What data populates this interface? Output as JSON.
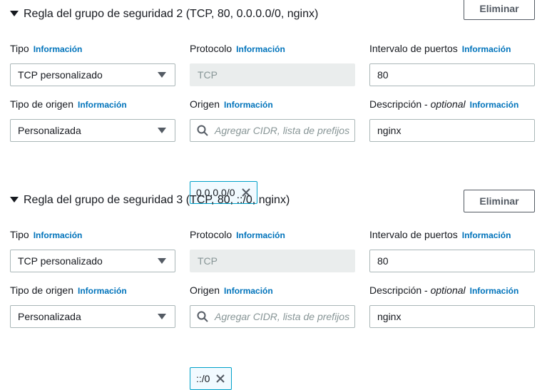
{
  "rules": [
    {
      "title": "Regla del grupo de seguridad 2 (TCP, 80, 0.0.0.0/0, nginx)",
      "delete_label": "Eliminar",
      "tipo_label": "Tipo",
      "tipo_value": "TCP personalizado",
      "protocolo_label": "Protocolo",
      "protocolo_value": "TCP",
      "puertos_label": "Intervalo de puertos",
      "puertos_value": "80",
      "origen_tipo_label": "Tipo de origen",
      "origen_tipo_value": "Personalizada",
      "origen_label": "Origen",
      "origen_placeholder": "Agregar CIDR, lista de prefijos",
      "origen_token": "0.0.0.0/0",
      "descripcion_label": "Descripción -",
      "descripcion_optional": "optional",
      "descripcion_value": "nginx"
    },
    {
      "title": "Regla del grupo de seguridad 3 (TCP, 80, ::/0, nginx)",
      "delete_label": "Eliminar",
      "tipo_label": "Tipo",
      "tipo_value": "TCP personalizado",
      "protocolo_label": "Protocolo",
      "protocolo_value": "TCP",
      "puertos_label": "Intervalo de puertos",
      "puertos_value": "80",
      "origen_tipo_label": "Tipo de origen",
      "origen_tipo_value": "Personalizada",
      "origen_label": "Origen",
      "origen_placeholder": "Agregar CIDR, lista de prefijos",
      "origen_token": "::/0",
      "descripcion_label": "Descripción -",
      "descripcion_optional": "optional",
      "descripcion_value": "nginx"
    }
  ],
  "info_label": "Información",
  "colors": {
    "link": "#0073bb",
    "token_border": "#00a1c9",
    "token_bg": "#f1faff",
    "disabled_bg": "#eaeded"
  },
  "icons": {
    "expand": "caret-down-icon",
    "select": "dropdown-arrow-icon",
    "search": "search-icon",
    "remove": "close-icon"
  }
}
